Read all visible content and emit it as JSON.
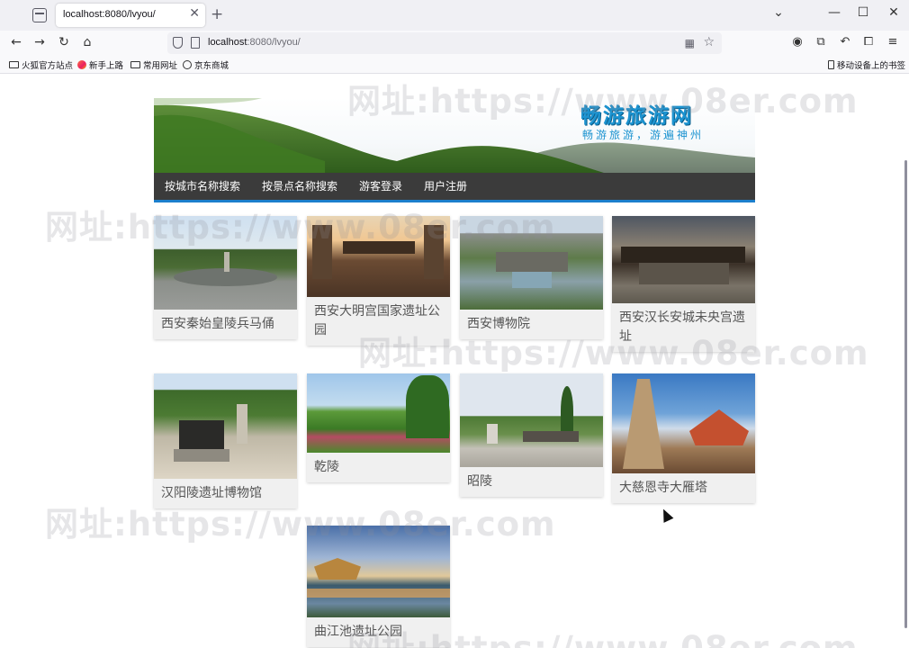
{
  "browser": {
    "tab_title": "localhost:8080/lvyou/",
    "tab_close": "✕",
    "new_tab": "+",
    "url_host": "localhost",
    "url_path": ":8080/lvyou/",
    "window_controls": {
      "list": "⌄",
      "minimize": "—",
      "maximize": "☐",
      "close": "✕"
    },
    "nav": {
      "back": "←",
      "forward": "→",
      "reload": "↻",
      "home": "⌂"
    },
    "bookmarks": [
      "火狐官方站点",
      "新手上路",
      "常用网址",
      "京东商城"
    ],
    "mobile_bookmarks": "移动设备上的书签"
  },
  "site": {
    "logo_title": "畅游旅游网",
    "logo_subtitle": "畅游旅游，游遍神州",
    "menu": [
      "按城市名称搜索",
      "按景点名称搜索",
      "游客登录",
      "用户注册"
    ]
  },
  "attractions": [
    {
      "name": "西安秦始皇陵兵马俑"
    },
    {
      "name": "西安大明宫国家遗址公园"
    },
    {
      "name": "西安博物院"
    },
    {
      "name": "西安汉长安城未央宫遗址"
    },
    {
      "name": "汉阳陵遗址博物馆"
    },
    {
      "name": "乾陵"
    },
    {
      "name": "昭陵"
    },
    {
      "name": "大慈恩寺大雁塔"
    },
    {
      "name": "曲江池遗址公园"
    }
  ],
  "watermark": "网址:https://www.08er.com",
  "colors": {
    "accent": "#1c93d0",
    "menu_bg": "#3b3b3b",
    "menu_border": "#1c7fcc",
    "card_bg": "#f0f0f0"
  }
}
